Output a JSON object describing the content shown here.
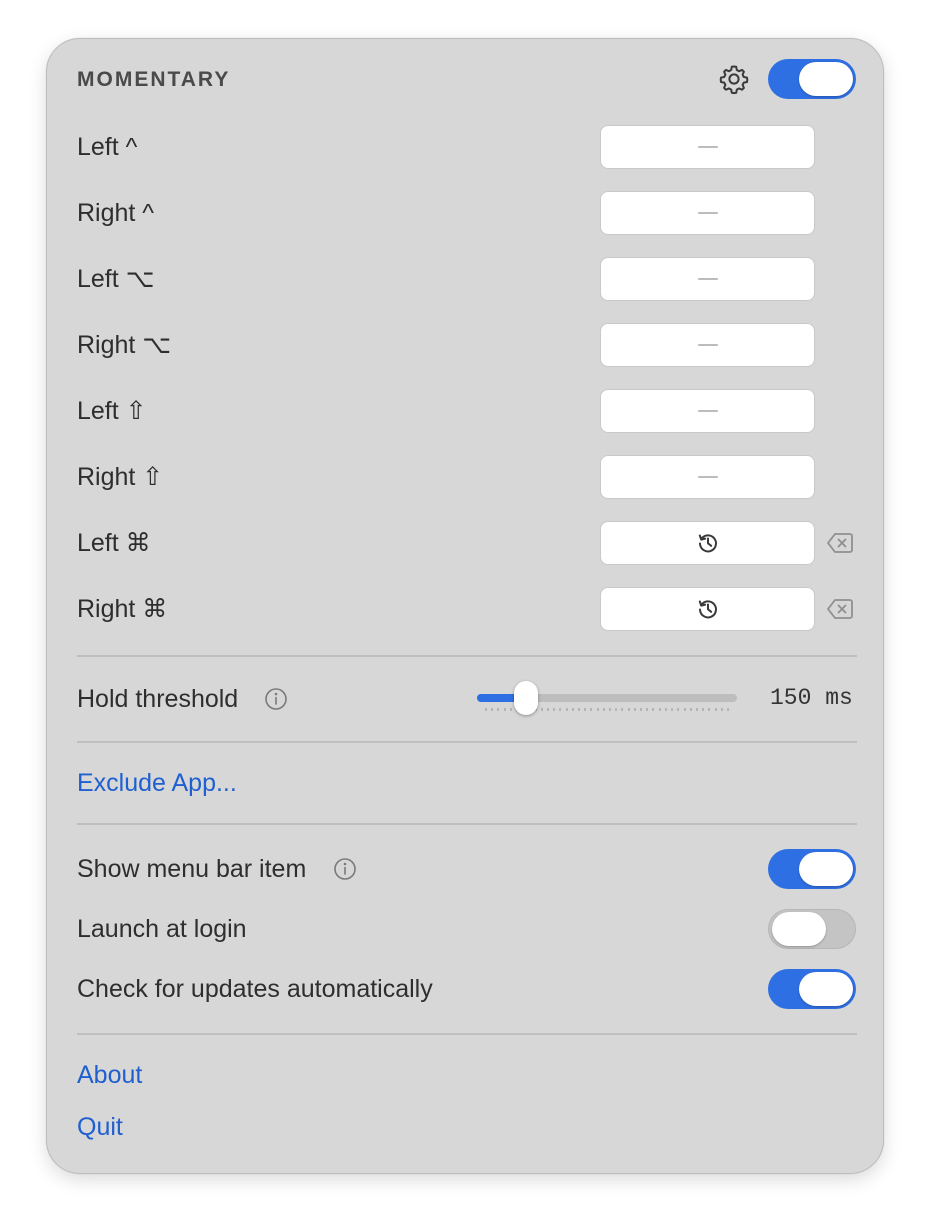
{
  "header": {
    "title": "MOMENTARY",
    "settings_icon": "gear-icon",
    "enabled": true
  },
  "keys": [
    {
      "label": "Left ^",
      "value": "—",
      "assigned": false
    },
    {
      "label": "Right ^",
      "value": "—",
      "assigned": false
    },
    {
      "label": "Left ⌥",
      "value": "—",
      "assigned": false
    },
    {
      "label": "Right ⌥",
      "value": "—",
      "assigned": false
    },
    {
      "label": "Left ⇧",
      "value": "—",
      "assigned": false
    },
    {
      "label": "Right ⇧",
      "value": "—",
      "assigned": false
    },
    {
      "label": "Left ⌘",
      "value": "history-icon",
      "assigned": true
    },
    {
      "label": "Right ⌘",
      "value": "history-icon",
      "assigned": true
    }
  ],
  "hold_threshold": {
    "label": "Hold threshold",
    "value_text": "150 ms",
    "fraction": 0.19
  },
  "exclude_app": {
    "label": "Exclude App..."
  },
  "options": [
    {
      "label": "Show menu bar item",
      "info": true,
      "on": true
    },
    {
      "label": "Launch at login",
      "info": false,
      "on": false
    },
    {
      "label": "Check for updates automatically",
      "info": false,
      "on": true
    }
  ],
  "footer": {
    "about": "About",
    "quit": "Quit"
  },
  "colors": {
    "accent": "#2f6fe4",
    "link": "#1f5fcf",
    "panel": "#d7d7d7"
  }
}
